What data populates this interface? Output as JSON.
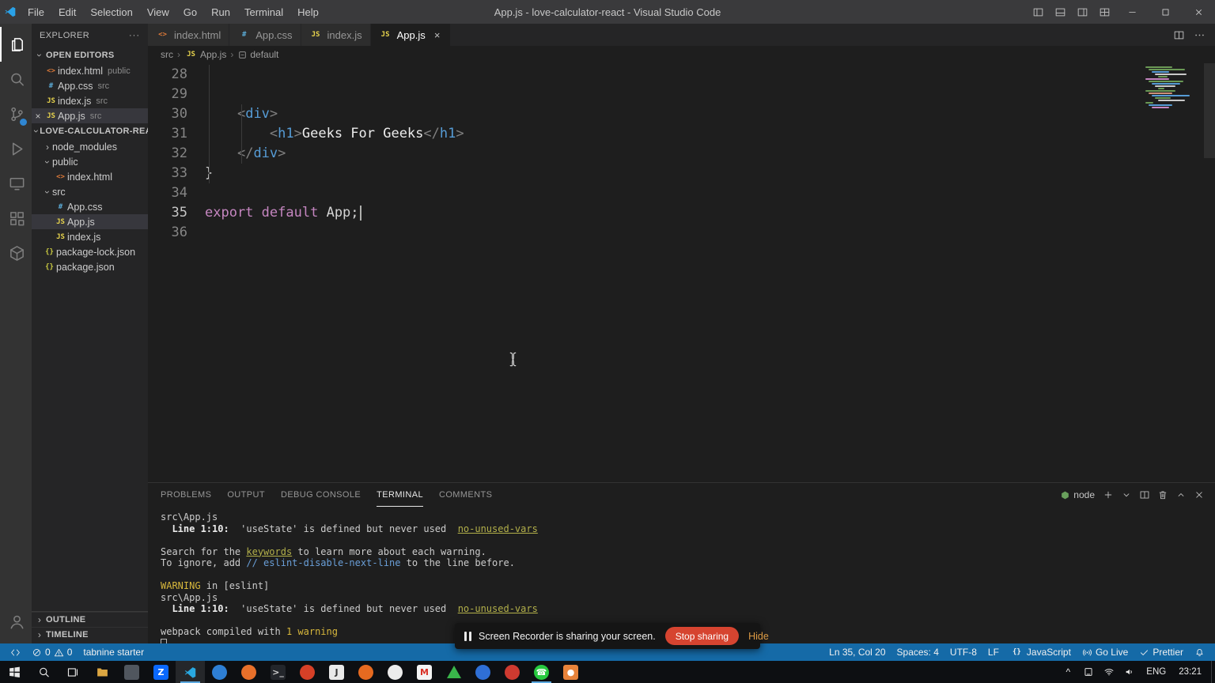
{
  "window": {
    "title": "App.js - love-calculator-react - Visual Studio Code"
  },
  "menu_bar": [
    "File",
    "Edit",
    "Selection",
    "View",
    "Go",
    "Run",
    "Terminal",
    "Help"
  ],
  "activity_bar": {
    "top": [
      {
        "name": "explorer",
        "active": true
      },
      {
        "name": "search"
      },
      {
        "name": "source-control",
        "badge": true
      },
      {
        "name": "run-and-debug"
      },
      {
        "name": "remote-explorer"
      },
      {
        "name": "extensions"
      },
      {
        "name": "references"
      }
    ],
    "bottom": [
      {
        "name": "accounts"
      }
    ]
  },
  "sidebar": {
    "title": "EXPLORER",
    "open_editors": {
      "label": "OPEN EDITORS",
      "items": [
        {
          "icon": "html",
          "name": "index.html",
          "detail": "public"
        },
        {
          "icon": "css",
          "name": "App.css",
          "detail": "src"
        },
        {
          "icon": "js",
          "name": "index.js",
          "detail": "src"
        },
        {
          "icon": "js",
          "name": "App.js",
          "detail": "src",
          "active": true
        }
      ]
    },
    "project": {
      "label": "LOVE-CALCULATOR-REACT",
      "items": [
        {
          "icon": "folder-collapsed",
          "name": "node_modules",
          "indent": 0
        },
        {
          "icon": "folder-expanded",
          "name": "public",
          "indent": 0
        },
        {
          "icon": "html",
          "name": "index.html",
          "indent": 1
        },
        {
          "icon": "folder-expanded",
          "name": "src",
          "indent": 0
        },
        {
          "icon": "css",
          "name": "App.css",
          "indent": 1
        },
        {
          "icon": "js",
          "name": "App.js",
          "indent": 1,
          "selected": true
        },
        {
          "icon": "js",
          "name": "index.js",
          "indent": 1
        },
        {
          "icon": "json",
          "name": "package-lock.json",
          "indent": 0
        },
        {
          "icon": "json",
          "name": "package.json",
          "indent": 0
        }
      ]
    },
    "bottom_sections": [
      "OUTLINE",
      "TIMELINE"
    ]
  },
  "editor": {
    "tabs": [
      {
        "icon": "html",
        "label": "index.html"
      },
      {
        "icon": "css",
        "label": "App.css"
      },
      {
        "icon": "js",
        "label": "index.js"
      },
      {
        "icon": "js",
        "label": "App.js",
        "active": true
      }
    ],
    "breadcrumb": [
      {
        "label": "src"
      },
      {
        "icon": "js",
        "label": "App.js"
      },
      {
        "icon": "symbol",
        "label": "default"
      }
    ],
    "lines": [
      {
        "num": "28",
        "tokens": []
      },
      {
        "num": "29",
        "tokens": []
      },
      {
        "num": "30",
        "tokens": [
          {
            "t": "    "
          },
          {
            "t": "<",
            "c": "punct"
          },
          {
            "t": "div",
            "c": "tag"
          },
          {
            "t": ">",
            "c": "punct"
          }
        ]
      },
      {
        "num": "31",
        "tokens": [
          {
            "t": "        "
          },
          {
            "t": "<",
            "c": "punct"
          },
          {
            "t": "h1",
            "c": "tag"
          },
          {
            "t": ">",
            "c": "punct"
          },
          {
            "t": "Geeks For Geeks",
            "c": "text"
          },
          {
            "t": "</",
            "c": "punct"
          },
          {
            "t": "h1",
            "c": "tag"
          },
          {
            "t": ">",
            "c": "punct"
          }
        ]
      },
      {
        "num": "32",
        "tokens": [
          {
            "t": "    "
          },
          {
            "t": "</",
            "c": "punct"
          },
          {
            "t": "div",
            "c": "tag"
          },
          {
            "t": ">",
            "c": "punct"
          }
        ]
      },
      {
        "num": "33",
        "tokens": [
          {
            "t": "}"
          }
        ]
      },
      {
        "num": "34",
        "tokens": []
      },
      {
        "num": "35",
        "active": true,
        "tokens": [
          {
            "t": "export",
            "c": "kw"
          },
          {
            "t": " "
          },
          {
            "t": "default",
            "c": "kw"
          },
          {
            "t": " "
          },
          {
            "t": "App;"
          },
          {
            "c": "cursor"
          }
        ]
      },
      {
        "num": "36",
        "tokens": []
      }
    ]
  },
  "panel": {
    "tabs": [
      {
        "label": "PROBLEMS"
      },
      {
        "label": "OUTPUT"
      },
      {
        "label": "DEBUG CONSOLE"
      },
      {
        "label": "TERMINAL",
        "active": true
      },
      {
        "label": "COMMENTS"
      }
    ],
    "shell": "node",
    "terminal_lines": [
      [
        {
          "t": "src\\App.js"
        }
      ],
      [
        {
          "t": "  "
        },
        {
          "t": "Line 1:10:",
          "c": "bold"
        },
        {
          "t": "  'useState' is defined but never used  "
        },
        {
          "t": "no-unused-vars",
          "c": "link"
        }
      ],
      [],
      [
        {
          "t": "Search for the "
        },
        {
          "t": "keywords",
          "c": "link"
        },
        {
          "t": " to learn more about each warning."
        }
      ],
      [
        {
          "t": "To ignore, add "
        },
        {
          "t": "// eslint-disable-next-line",
          "c": "code"
        },
        {
          "t": " to the line before."
        }
      ],
      [],
      [
        {
          "t": "WARNING",
          "c": "warn"
        },
        {
          "t": " in [eslint]"
        }
      ],
      [
        {
          "t": "src\\App.js"
        }
      ],
      [
        {
          "t": "  "
        },
        {
          "t": "Line 1:10:",
          "c": "bold"
        },
        {
          "t": "  'useState' is defined but never used  "
        },
        {
          "t": "no-unused-vars",
          "c": "link"
        }
      ],
      [],
      [
        {
          "t": "webpack compiled with "
        },
        {
          "t": "1 warning",
          "c": "warn"
        }
      ],
      [
        {
          "c": "cursor"
        }
      ]
    ]
  },
  "notification": {
    "message": "Screen Recorder is sharing your screen.",
    "stop_button": "Stop sharing",
    "hide_button": "Hide"
  },
  "status_bar": {
    "errors": "0",
    "warnings": "0",
    "tabnine": "tabnine starter",
    "right": {
      "cursor_position": "Ln 35, Col 20",
      "indentation": "Spaces: 4",
      "encoding": "UTF-8",
      "eol": "LF",
      "language": "JavaScript",
      "go_live": "Go Live",
      "prettier": "Prettier"
    }
  },
  "taskbar": {
    "apps": [
      {
        "name": "start",
        "icon": "windows"
      },
      {
        "name": "search",
        "icon": "search"
      },
      {
        "name": "task-view",
        "icon": "taskview"
      },
      {
        "name": "file-explorer",
        "icon": "folder"
      },
      {
        "name": "app-1",
        "shape": "square",
        "bg": "#50565e"
      },
      {
        "name": "zalo",
        "shape": "square",
        "bg": "#0a68fe",
        "glyph": "Z",
        "fg": "#ffffff"
      },
      {
        "name": "vscode",
        "icon": "vscode",
        "active": true,
        "open": true
      },
      {
        "name": "app-2",
        "shape": "circle",
        "bg": "#2e7fd4"
      },
      {
        "name": "app-3",
        "shape": "circle",
        "bg": "#e8702a"
      },
      {
        "name": "terminal-app",
        "shape": "square",
        "bg": "#23262b",
        "glyph": ">_",
        "fg": "#d0d0d0"
      },
      {
        "name": "brave",
        "shape": "circle",
        "bg": "#d64027"
      },
      {
        "name": "app-4",
        "shape": "square",
        "bg": "#e9e9e9",
        "glyph": "J",
        "fg": "#333333"
      },
      {
        "name": "firefox",
        "shape": "circle",
        "bg": "#e66a20"
      },
      {
        "name": "app-5",
        "shape": "circle",
        "bg": "#ececec"
      },
      {
        "name": "gmail",
        "shape": "square",
        "bg": "#f4f4f4",
        "glyph": "M",
        "fg": "#d93025"
      },
      {
        "name": "app-6",
        "shape": "triangle",
        "bg": "#39b54a"
      },
      {
        "name": "edge",
        "shape": "circle",
        "bg": "#2f6fd6"
      },
      {
        "name": "app-7",
        "shape": "circle",
        "bg": "#cf3a30"
      },
      {
        "name": "whatsapp",
        "shape": "circle",
        "bg": "#27c93f",
        "glyph": "☎",
        "fg": "#ffffff",
        "open": true
      },
      {
        "name": "screen-recorder",
        "shape": "square",
        "bg": "#e8833a",
        "glyph": "●",
        "fg": "#ffffff"
      }
    ],
    "tray_icons": [
      "chevron-up",
      "pc",
      "wifi",
      "volume"
    ],
    "tray_language": "ENG",
    "tray_time": "23:21"
  },
  "colors": {
    "status_bar": "#156aa7",
    "stop_button": "#d64430",
    "accent_blue": "#2f86d2"
  }
}
